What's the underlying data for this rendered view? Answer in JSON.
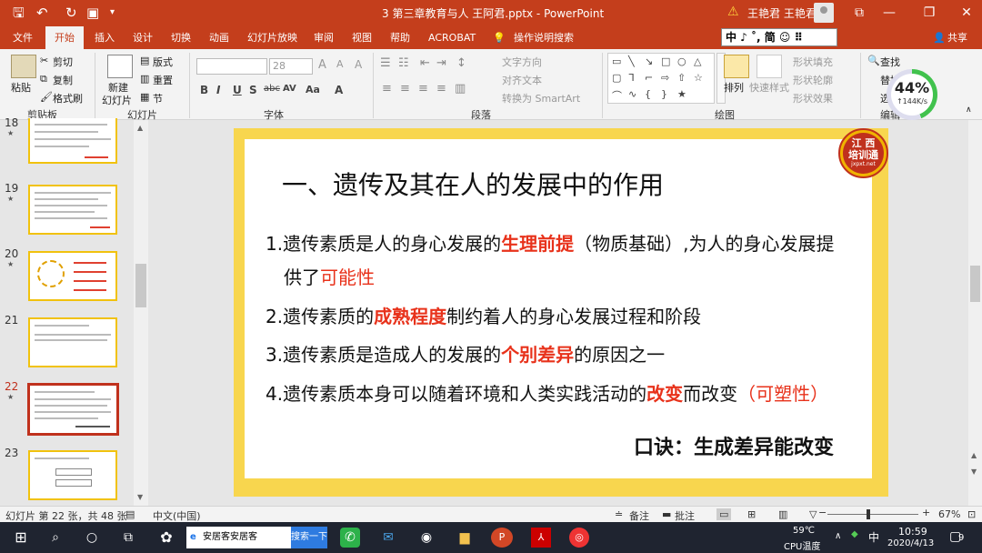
{
  "titlebar": {
    "document_title": "3  第三章教育与人  王阿君.pptx  -  PowerPoint",
    "user_name": "王艳君 王艳君",
    "save_icon": "save-icon",
    "undo_icon": "undo-icon",
    "redo_icon": "redo-icon"
  },
  "menu": {
    "tabs": [
      "文件",
      "开始",
      "插入",
      "设计",
      "切换",
      "动画",
      "幻灯片放映",
      "审阅",
      "视图",
      "帮助",
      "ACROBAT"
    ],
    "tell_me": "操作说明搜索",
    "share": "共享",
    "ime_text": "中 ♪ ˚, 简 ☺ ⠿"
  },
  "ribbon": {
    "clipboard": {
      "label": "剪贴板",
      "paste": "粘贴",
      "cut": "剪切",
      "copy": "复制",
      "format_painter": "格式刷"
    },
    "slides": {
      "label": "幻灯片",
      "new_slide_1": "新建",
      "new_slide_2": "幻灯片",
      "layout": "版式",
      "reset": "重置",
      "section": "节"
    },
    "font": {
      "label": "字体",
      "size": "28"
    },
    "paragraph": {
      "label": "段落",
      "text_direction": "文字方向",
      "align_text": "对齐文本",
      "smartart": "转换为 SmartArt"
    },
    "drawing": {
      "label": "绘图",
      "arrange": "排列",
      "quick_styles": "快速样式",
      "shape_fill": "形状填充",
      "shape_outline": "形状轮廓",
      "shape_effects": "形状效果"
    },
    "editing": {
      "label": "编辑",
      "find": "查找",
      "replace": "替换",
      "select": "选"
    }
  },
  "network_widget": {
    "percent": "44%",
    "speed": "↑144K/s"
  },
  "thumbnails": [
    {
      "num": "18"
    },
    {
      "num": "19"
    },
    {
      "num": "20"
    },
    {
      "num": "21"
    },
    {
      "num": "22"
    },
    {
      "num": "23"
    }
  ],
  "slide": {
    "title": "一、遗传及其在人的发展中的作用",
    "logo_line1": "江 西",
    "logo_line2": "培训通",
    "logo_line3": "jxpxt.net",
    "b1_pre": "1.遗传素质是人的身心发展的",
    "b1_red": "生理前提",
    "b1_post": "（物质基础）,为人的身心发展提",
    "b1b_pre": "供了",
    "b1b_red": "可能性",
    "b2_pre": "2.遗传素质的",
    "b2_red": "成熟程度",
    "b2_post": "制约着人的身心发展过程和阶段",
    "b3_pre": "3.遗传素质是造成人的发展的",
    "b3_red": "个别差异",
    "b3_post": "的原因之一",
    "b4_pre": "4.遗传素质本身可以随着环境和人类实践活动的",
    "b4_red": "改变",
    "b4_mid": "而改变",
    "b4_red2": "（可塑性）",
    "mnemonic": "口诀：生成差异能改变"
  },
  "status": {
    "slide_info": "幻灯片 第 22 张，共 48 张",
    "language": "中文(中国)",
    "notes": "备注",
    "comments": "批注",
    "zoom": "67%"
  },
  "taskbar": {
    "search_text": "安居客安居客",
    "search_button": "搜索一下",
    "temperature": "59℃",
    "cpu_label": "CPU温度",
    "ime": "中",
    "time": "10:59",
    "date": "2020/4/13",
    "notifications": "9"
  }
}
